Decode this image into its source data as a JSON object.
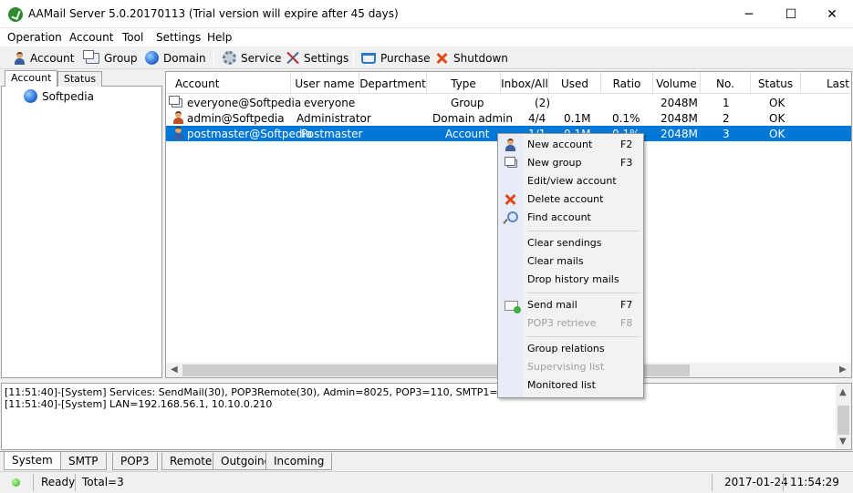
{
  "window": {
    "title": "AAMail Server 5.0.20170113 (Trial version will expire after 45 days)",
    "min_glyph": "─",
    "max_glyph": "☐",
    "close_glyph": "✕"
  },
  "menu": [
    "Operation",
    "Account",
    "Tool",
    "Settings",
    "Help"
  ],
  "toolbar": {
    "account": "Account",
    "group": "Group",
    "domain": "Domain",
    "service": "Service",
    "settings": "Settings",
    "purchase": "Purchase",
    "shutdown": "Shutdown"
  },
  "left_tabs": [
    "Account",
    "Status"
  ],
  "tree": {
    "root": "Softpedia"
  },
  "grid": {
    "columns": [
      "Account",
      "User name",
      "Department",
      "Type",
      "Inbox/All",
      "Used",
      "Ratio",
      "Volume",
      "No.",
      "Status",
      "Last v"
    ],
    "rows": [
      {
        "account": "everyone@Softpedia",
        "user": "everyone",
        "dept": "",
        "type": "Group",
        "inbox": "(2)",
        "used": "",
        "ratio": "",
        "volume": "2048M",
        "no": "1",
        "status": "OK",
        "icon": "group-icon"
      },
      {
        "account": "admin@Softpedia",
        "user": "Administrator",
        "dept": "",
        "type": "Domain admin",
        "inbox": "4/4",
        "used": "0.1M",
        "ratio": "0.1%",
        "volume": "2048M",
        "no": "2",
        "status": "OK",
        "icon": "admin-user-icon"
      },
      {
        "account": "postmaster@Softpedia",
        "user": "Postmaster",
        "dept": "",
        "type": "Account",
        "inbox": "1/1",
        "used": "0.1M",
        "ratio": "0.1%",
        "volume": "2048M",
        "no": "3",
        "status": "OK",
        "icon": "user-icon",
        "selected": true
      }
    ]
  },
  "log": [
    "[11:51:40]-[System] Services: SendMail(30), POP3Remote(30), Admin=8025, POP3=110, SMTP1=25, SMTP2=0",
    "[11:51:40]-[System] LAN=192.168.56.1, 10.10.0.210"
  ],
  "bottom_tabs": [
    "System",
    "SMTP",
    "POP3",
    "Remote",
    "Outgoing",
    "Incoming"
  ],
  "status": {
    "ready": "Ready",
    "total": "Total=3",
    "date": "2017-01-24",
    "time": "11:54:29"
  },
  "context_menu": {
    "new_account": "New account",
    "new_account_key": "F2",
    "new_group": "New group",
    "new_group_key": "F3",
    "edit_view": "Edit/view account",
    "delete": "Delete account",
    "find": "Find account",
    "clear_sendings": "Clear sendings",
    "clear_mails": "Clear mails",
    "drop_history": "Drop history mails",
    "send_mail": "Send mail",
    "send_mail_key": "F7",
    "pop3_retrieve": "POP3 retrieve",
    "pop3_retrieve_key": "F8",
    "group_relations": "Group relations",
    "supervising": "Supervising list",
    "monitored": "Monitored list"
  },
  "colors": {
    "selection": "#0078d7",
    "window_bg": "#f0f0f0",
    "menu_gutter": "#e8ecf7"
  },
  "watermark": "SOFTPEDIA"
}
